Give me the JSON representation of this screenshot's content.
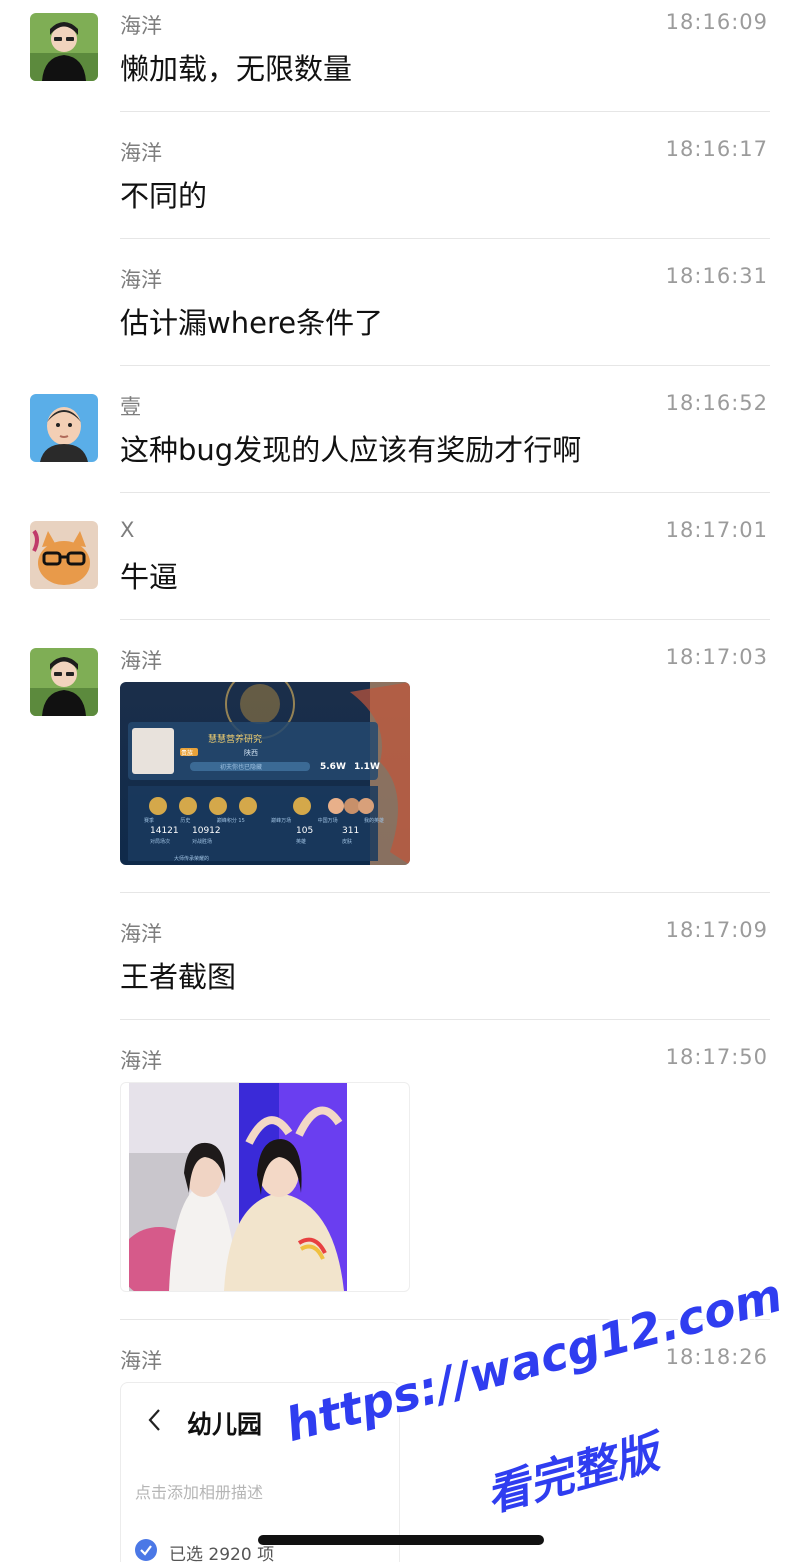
{
  "messages": [
    {
      "sender": "海洋",
      "time": "18:16:09",
      "text": "懒加载，无限数量"
    },
    {
      "sender": "海洋",
      "time": "18:16:17",
      "text": "不同的"
    },
    {
      "sender": "海洋",
      "time": "18:16:31",
      "text": "估计漏where条件了"
    },
    {
      "sender": "壹",
      "time": "18:16:52",
      "text": "这种bug发现的人应该有奖励才行啊"
    },
    {
      "sender": "X",
      "time": "18:17:01",
      "text": "牛逼"
    },
    {
      "sender": "海洋",
      "time": "18:17:03"
    },
    {
      "sender": "海洋",
      "time": "18:17:09",
      "text": "王者截图"
    },
    {
      "sender": "海洋",
      "time": "18:17:50"
    },
    {
      "sender": "海洋",
      "time": "18:18:26"
    }
  ],
  "game_screenshot": {
    "game_title": "慧慧营养研究",
    "rank_badge": "贵族",
    "location": "陕西",
    "status_field": "初夫你也已隐藏",
    "hot_value": "5.6W",
    "like_value": "1.1W",
    "stats": [
      {
        "value": "14121",
        "label": "对局场次"
      },
      {
        "value": "10912",
        "label": "对战胜场"
      },
      {
        "value": "105",
        "label": "英雄"
      },
      {
        "value": "311",
        "label": "皮肤"
      }
    ],
    "medal_labels": [
      "赛季",
      "历史",
      "巅峰积分 15",
      "巅峰万场",
      "中国万场",
      "我的英雄"
    ],
    "bottom_text": "大师传承荣耀的"
  },
  "album_card": {
    "back_icon": "chevron-left-icon",
    "title": "幼儿园",
    "description_placeholder": "点击添加相册描述",
    "selected_text": "已选 2920 项"
  },
  "watermark": {
    "line1": "https://wacg12.com",
    "line2": "看完整版"
  },
  "colors": {
    "accent": "#4b78e6",
    "watermark": "#2f3df0"
  }
}
